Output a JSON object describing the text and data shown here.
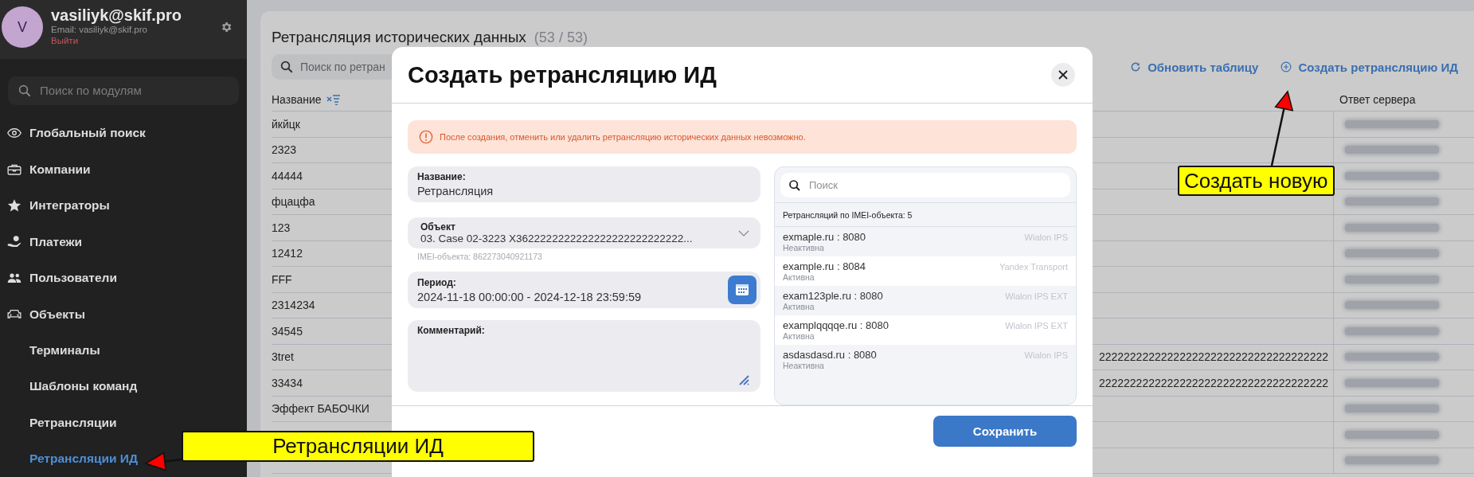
{
  "user": {
    "name": "vasiliyk@skif.pro",
    "initial": "V",
    "email": "Email: vasiliyk@skif.pro",
    "logout": "Выйти"
  },
  "sidebar": {
    "search": {
      "placeholder": "Поиск по модулям"
    },
    "items": [
      {
        "label": "Глобальный поиск",
        "selected": false
      },
      {
        "label": "Компании",
        "selected": false
      },
      {
        "label": "Интеграторы",
        "selected": false
      },
      {
        "label": "Платежи",
        "selected": false
      },
      {
        "label": "Пользователи",
        "selected": false
      },
      {
        "label": "Объекты",
        "selected": false,
        "expanded": true,
        "children": [
          {
            "label": "Терминалы",
            "selected": false
          },
          {
            "label": "Шаблоны команд",
            "selected": false
          },
          {
            "label": "Ретрансляции",
            "selected": false
          },
          {
            "label": "Ретрансляции ИД",
            "selected": true
          }
        ]
      }
    ]
  },
  "page": {
    "title": "Ретрансляция исторических данных",
    "count": "(53 / 53)",
    "search": {
      "placeholder": "Поиск по ретран"
    },
    "toolbar": [
      {
        "label": "Обновить таблицу",
        "kind": "refresh"
      },
      {
        "label": "Создать ретрансляцию ИД",
        "kind": "create"
      }
    ]
  },
  "table": {
    "columns": [
      {
        "label": "Название"
      },
      {
        "label": "Ответ сервера"
      }
    ],
    "rows": [
      {
        "name": "йкйцк",
        "redacted": true
      },
      {
        "name": "2323",
        "redacted": true
      },
      {
        "name": "44444",
        "redacted": true
      },
      {
        "name": "фцацфа",
        "redacted": true
      },
      {
        "name": "123",
        "redacted": true
      },
      {
        "name": "12412",
        "redacted": true
      },
      {
        "name": "FFF",
        "redacted": true
      },
      {
        "name": "2314234",
        "redacted": true
      },
      {
        "name": "34545",
        "redacted": true
      },
      {
        "name": "3tret",
        "column_2": "2222222222222222222222222222222222222",
        "redacted": true
      },
      {
        "name": "33434",
        "column_2": "2222222222222222222222222222222222222",
        "redacted": true
      },
      {
        "name": "Эффект БАБОЧКИ",
        "redacted": true
      },
      {
        "redacted": true
      },
      {
        "redacted": true
      }
    ]
  },
  "modal": {
    "title": "Создать ретрансляцию ИД",
    "alert": "После создания, отменить или удалить ретрансляцию исторических данных невозможно.",
    "name_field": {
      "label": "Название:",
      "value": "Ретрансляция"
    },
    "object_field": {
      "label": "Объект",
      "value": "03. Case 02-3223 X3622222222222222222222222222...",
      "hint": "IMEI-объекта: 862273040921173"
    },
    "period_field": {
      "label": "Период:",
      "value": "2024-11-18 00:00:00 - 2024-12-18 23:59:59"
    },
    "comment_field": {
      "label": "Комментарий:"
    },
    "list": {
      "search": {
        "placeholder": "Поиск"
      },
      "count": "Ретрансляций по IMEI-объекта: 5",
      "items": [
        {
          "host": "exmaple.ru : 8080",
          "status": "Неактивна",
          "protocol": "Wialon IPS"
        },
        {
          "host": "example.ru : 8084",
          "status": "Активна",
          "protocol": "Yandex Transport"
        },
        {
          "host": "exam123ple.ru : 8080",
          "status": "Активна",
          "protocol": "Wialon IPS EXT"
        },
        {
          "host": "examplqqqqe.ru : 8080",
          "status": "Активна",
          "protocol": "Wialon IPS EXT"
        },
        {
          "host": "asdasdasd.ru : 8080",
          "status": "Неактивна",
          "protocol": "Wialon IPS"
        }
      ]
    },
    "save_button": "Сохранить"
  },
  "annotations": [
    {
      "text": "Создать новую",
      "kind": "up"
    },
    {
      "text": "Ретрансляции ИД",
      "kind": "left"
    }
  ]
}
